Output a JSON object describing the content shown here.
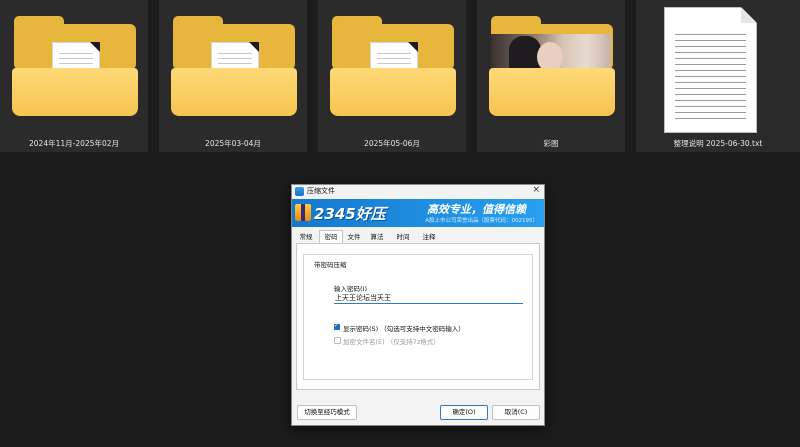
{
  "files": [
    {
      "kind": "folder",
      "name": "2024年11月-2025年02月",
      "icon": "folder-icon"
    },
    {
      "kind": "folder",
      "name": "2025年03-04月",
      "icon": "folder-icon"
    },
    {
      "kind": "folder",
      "name": "2025年05-06月",
      "icon": "folder-icon"
    },
    {
      "kind": "folder-with-photo",
      "name": "彩图",
      "icon": "folder-icon"
    },
    {
      "kind": "text-file",
      "name": "整理说明 2025-06-30.txt",
      "icon": "text-document-icon"
    }
  ],
  "dialog": {
    "title": "压缩文件",
    "close_glyph": "×",
    "banner": {
      "brand": "2345好压",
      "slogan": "高效专业，值得信赖",
      "subline": "A股上市公司荣誉出品（股票代码：002195）"
    },
    "tabs": [
      {
        "label": "常规",
        "active": false
      },
      {
        "label": "密码",
        "active": true
      },
      {
        "label": "文件",
        "active": false
      },
      {
        "label": "算法",
        "active": false
      },
      {
        "label": "时间",
        "active": false
      },
      {
        "label": "注释",
        "active": false
      }
    ],
    "group_title": "带密码压缩",
    "password_label": "输入密码(I)",
    "password_value": "上天王论坛当天王",
    "show_password": {
      "label": "显示密码(S) （勾选可支持中文密码输入）",
      "checked": true,
      "enabled": true
    },
    "encrypt_names": {
      "label": "加密文件名(E) （仅支持7z格式）",
      "checked": false,
      "enabled": false
    },
    "buttons": {
      "switch_mode": "切换至经巧模式",
      "ok": "确定(O)",
      "cancel": "取消(C)"
    }
  },
  "colors": {
    "desktop_bg": "#1c1c1c",
    "tile_bg": "#2b2b2b",
    "folder_yellow": "#f6c550",
    "banner_blue": "#1478d0",
    "accent_blue": "#2b7ad0"
  }
}
